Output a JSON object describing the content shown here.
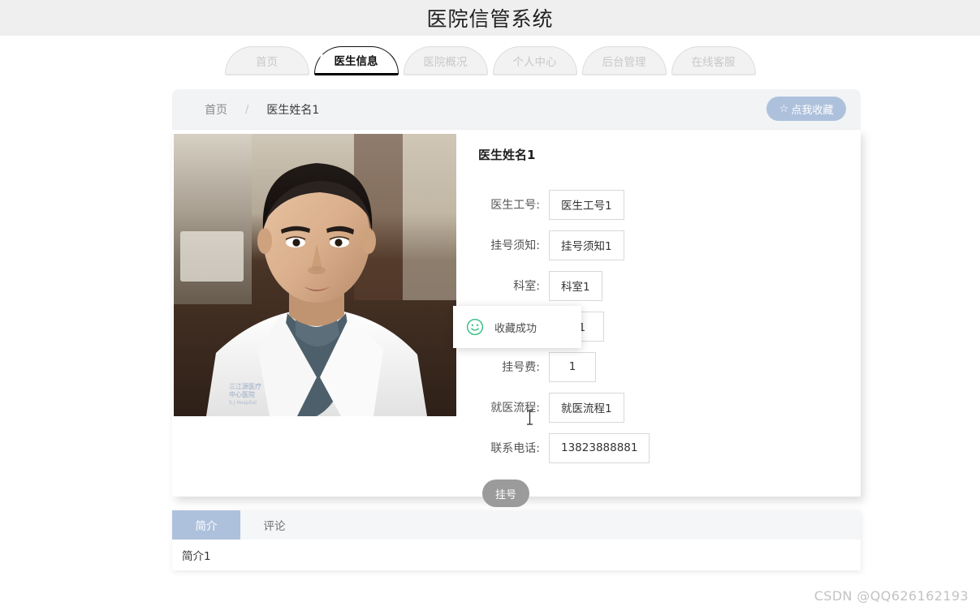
{
  "header": {
    "title": "医院信管系统"
  },
  "nav": {
    "tabs": [
      {
        "label": "首页",
        "active": false
      },
      {
        "label": "医生信息",
        "active": true
      },
      {
        "label": "医院概况",
        "active": false
      },
      {
        "label": "个人中心",
        "active": false
      },
      {
        "label": "后台管理",
        "active": false
      },
      {
        "label": "在线客服",
        "active": false
      }
    ]
  },
  "breadcrumb": {
    "home": "首页",
    "separator": "/",
    "current": "医生姓名1",
    "favorite_button": {
      "icon": "☆",
      "label": "点我收藏"
    }
  },
  "detail": {
    "doctor_name": "医生姓名1",
    "fields": [
      {
        "label": "医生工号:",
        "value": "医生工号1"
      },
      {
        "label": "挂号须知:",
        "value": "挂号须知1"
      },
      {
        "label": "科室:",
        "value": "科室1"
      },
      {
        "label": "",
        "value": "尔1"
      },
      {
        "label": "挂号费:",
        "value": "1"
      },
      {
        "label": "就医流程:",
        "value": "就医流程1"
      },
      {
        "label": "联系电话:",
        "value": "13823888881"
      }
    ],
    "book_button": "挂号"
  },
  "toast": {
    "icon": "smiley-icon",
    "message": "收藏成功"
  },
  "bottom": {
    "tabs": [
      {
        "label": "简介",
        "active": true
      },
      {
        "label": "评论",
        "active": false
      }
    ],
    "content": "简介1"
  },
  "watermark": "CSDN @QQ626162193",
  "colors": {
    "header_bg": "#efefef",
    "accent_blue": "#aec1dc",
    "crumb_bg": "#f2f3f5",
    "button_gray": "#9b9b9b",
    "toast_green": "#2dbd7e"
  }
}
